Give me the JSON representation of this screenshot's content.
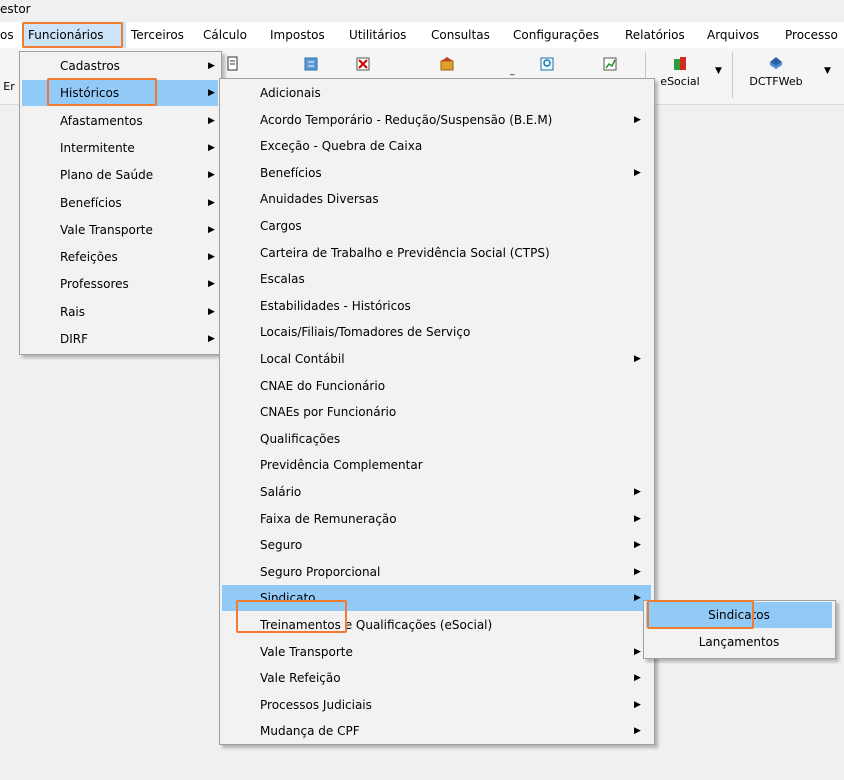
{
  "window": {
    "title": "estor"
  },
  "menubar": {
    "items": [
      "os",
      "Funcionários",
      "Terceiros",
      "Cálculo",
      "Impostos",
      "Utilitários",
      "Consultas",
      "Configurações",
      "Relatórios",
      "Arquivos",
      "Processo"
    ]
  },
  "toolbar": {
    "partial_label": "Er",
    "esocial_label": "eSocial",
    "dctfweb_label": "DCTFWeb"
  },
  "menu1": {
    "items": [
      "Cadastros",
      "Históricos",
      "Afastamentos",
      "Intermitente",
      "Plano de Saúde",
      "Benefícios",
      "Vale Transporte",
      "Refeições",
      "Professores",
      "Rais",
      "DIRF"
    ]
  },
  "menu2": {
    "items": [
      "Adicionais",
      "Acordo Temporário - Redução/Suspensão (B.E.M)",
      "Exceção - Quebra de Caixa",
      "Benefícios",
      "Anuidades Diversas",
      "Cargos",
      "Carteira de Trabalho e Previdência Social (CTPS)",
      "Escalas",
      "Estabilidades - Históricos",
      "Locais/Filiais/Tomadores de Serviço",
      "Local Contábil",
      "CNAE do Funcionário",
      "CNAEs por Funcionário",
      "Qualificações",
      "Previdência Complementar",
      "Salário",
      "Faixa de Remuneração",
      "Seguro",
      "Seguro Proporcional",
      "Sindicato",
      "Treinamentos e Qualificações (eSocial)",
      "Vale Transporte",
      "Vale Refeição",
      "Processos Judiciais",
      "Mudança de CPF"
    ]
  },
  "menu3": {
    "items": [
      "Sindicatos",
      "Lançamentos"
    ]
  },
  "colors": {
    "highlight_border": "#f07c33",
    "selected_row": "#91c9f7",
    "menu_bg": "#f2f2f2"
  },
  "icons": {
    "submenu_arrow": "▶"
  }
}
